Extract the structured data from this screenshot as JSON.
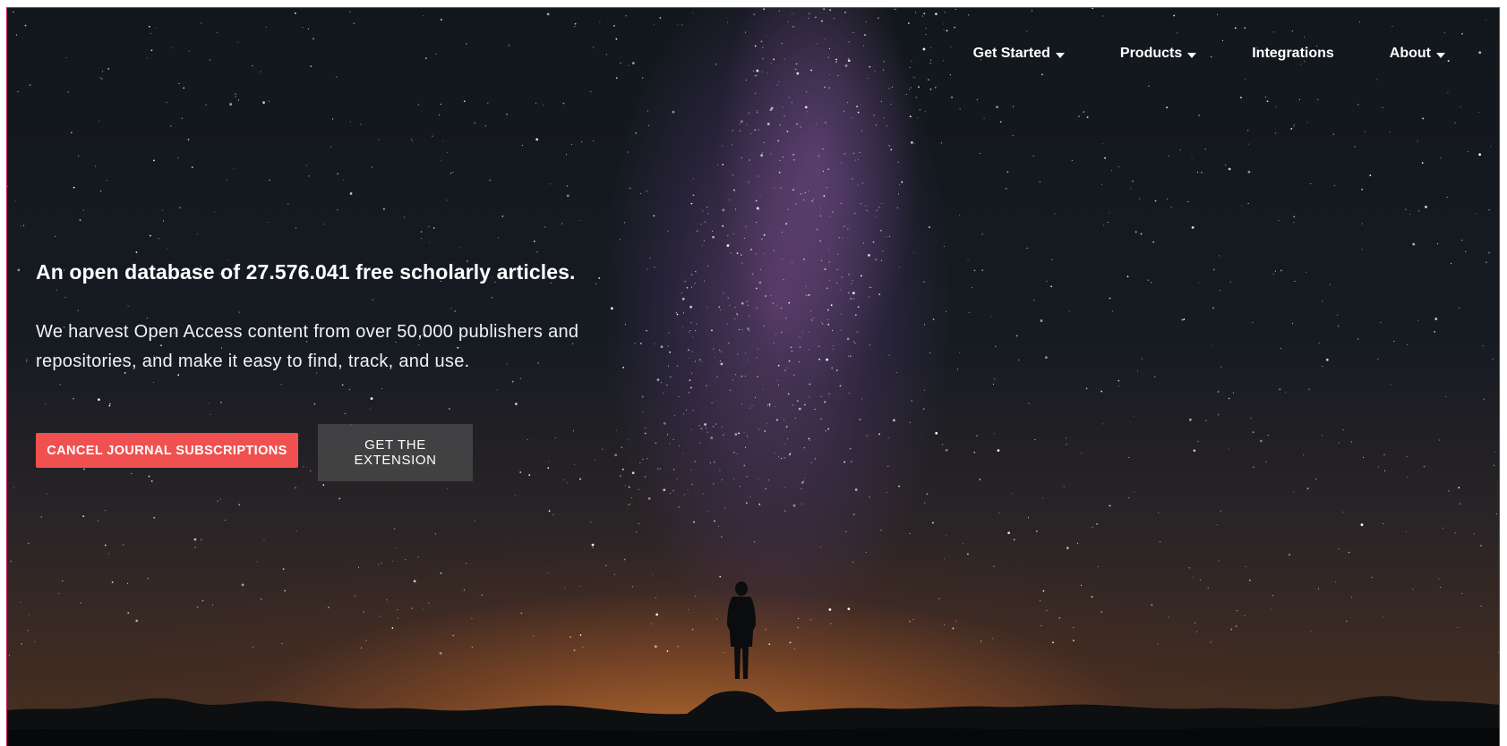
{
  "nav": {
    "items": [
      {
        "label": "Get Started",
        "dropdown": true
      },
      {
        "label": "Products",
        "dropdown": true
      },
      {
        "label": "Integrations",
        "dropdown": false
      },
      {
        "label": "About",
        "dropdown": true
      }
    ]
  },
  "hero": {
    "headline": "An open database of 27.576.041 free scholarly articles.",
    "subtext": "We harvest Open Access content from over 50,000 publishers and repositories, and make it easy to find, track, and use.",
    "primary_button": "CANCEL JOURNAL SUBSCRIPTIONS",
    "secondary_button": "GET THE EXTENSION"
  },
  "colors": {
    "accent": "#f0504f",
    "frame_border": "#c2185b",
    "secondary_button_bg": "#464648"
  }
}
